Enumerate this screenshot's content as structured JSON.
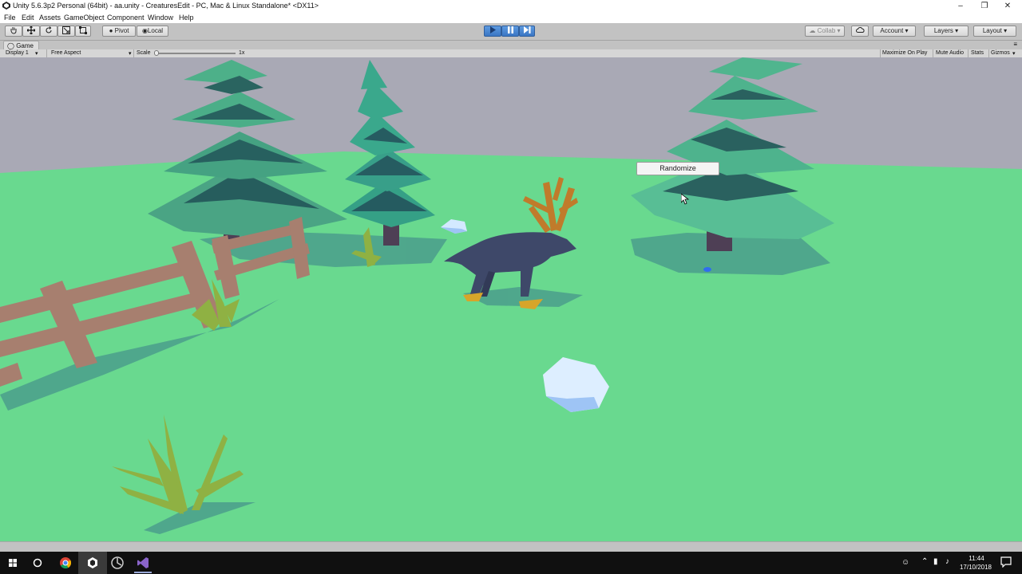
{
  "window": {
    "title": "Unity 5.6.3p2 Personal (64bit) - aa.unity - CreaturesEdit - PC, Mac & Linux Standalone* <DX11>",
    "app_icon": "unity-icon",
    "controls": [
      "minimize-icon",
      "restore-icon",
      "close-icon"
    ]
  },
  "menu": {
    "items": [
      "File",
      "Edit",
      "Assets",
      "GameObject",
      "Component",
      "Window",
      "Help"
    ]
  },
  "toolbar": {
    "transform_tools": [
      "hand-icon",
      "move-icon",
      "rotate-icon",
      "scale-icon",
      "rect-icon"
    ],
    "pivot_label": "Pivot",
    "local_label": "Local",
    "play_controls": [
      "play-icon",
      "pause-icon",
      "step-icon"
    ],
    "play_state": "playing",
    "collab_label": "Collab",
    "account_label": "Account",
    "layers_label": "Layers",
    "layout_label": "Layout"
  },
  "game_view": {
    "tab_label": "Game",
    "display": "Display 1",
    "aspect": "Free Aspect",
    "scale_label": "Scale",
    "scale_value": "1x",
    "toggles": [
      "Maximize On Play",
      "Mute Audio",
      "Stats",
      "Gizmos"
    ]
  },
  "scene": {
    "randomize_label": "Randomize",
    "colors": {
      "sky": "#a7a7b3",
      "ground": "#67d88e",
      "pine": "#3fa27e",
      "wolf": "#3d4768",
      "antlers": "#b9762a"
    }
  },
  "taskbar": {
    "time": "11:44",
    "date": "17/10/2018",
    "apps": [
      "windows-start-icon",
      "search-icon",
      "chrome-icon",
      "unity-icon",
      "unity-hub-icon",
      "visual-studio-icon"
    ]
  }
}
